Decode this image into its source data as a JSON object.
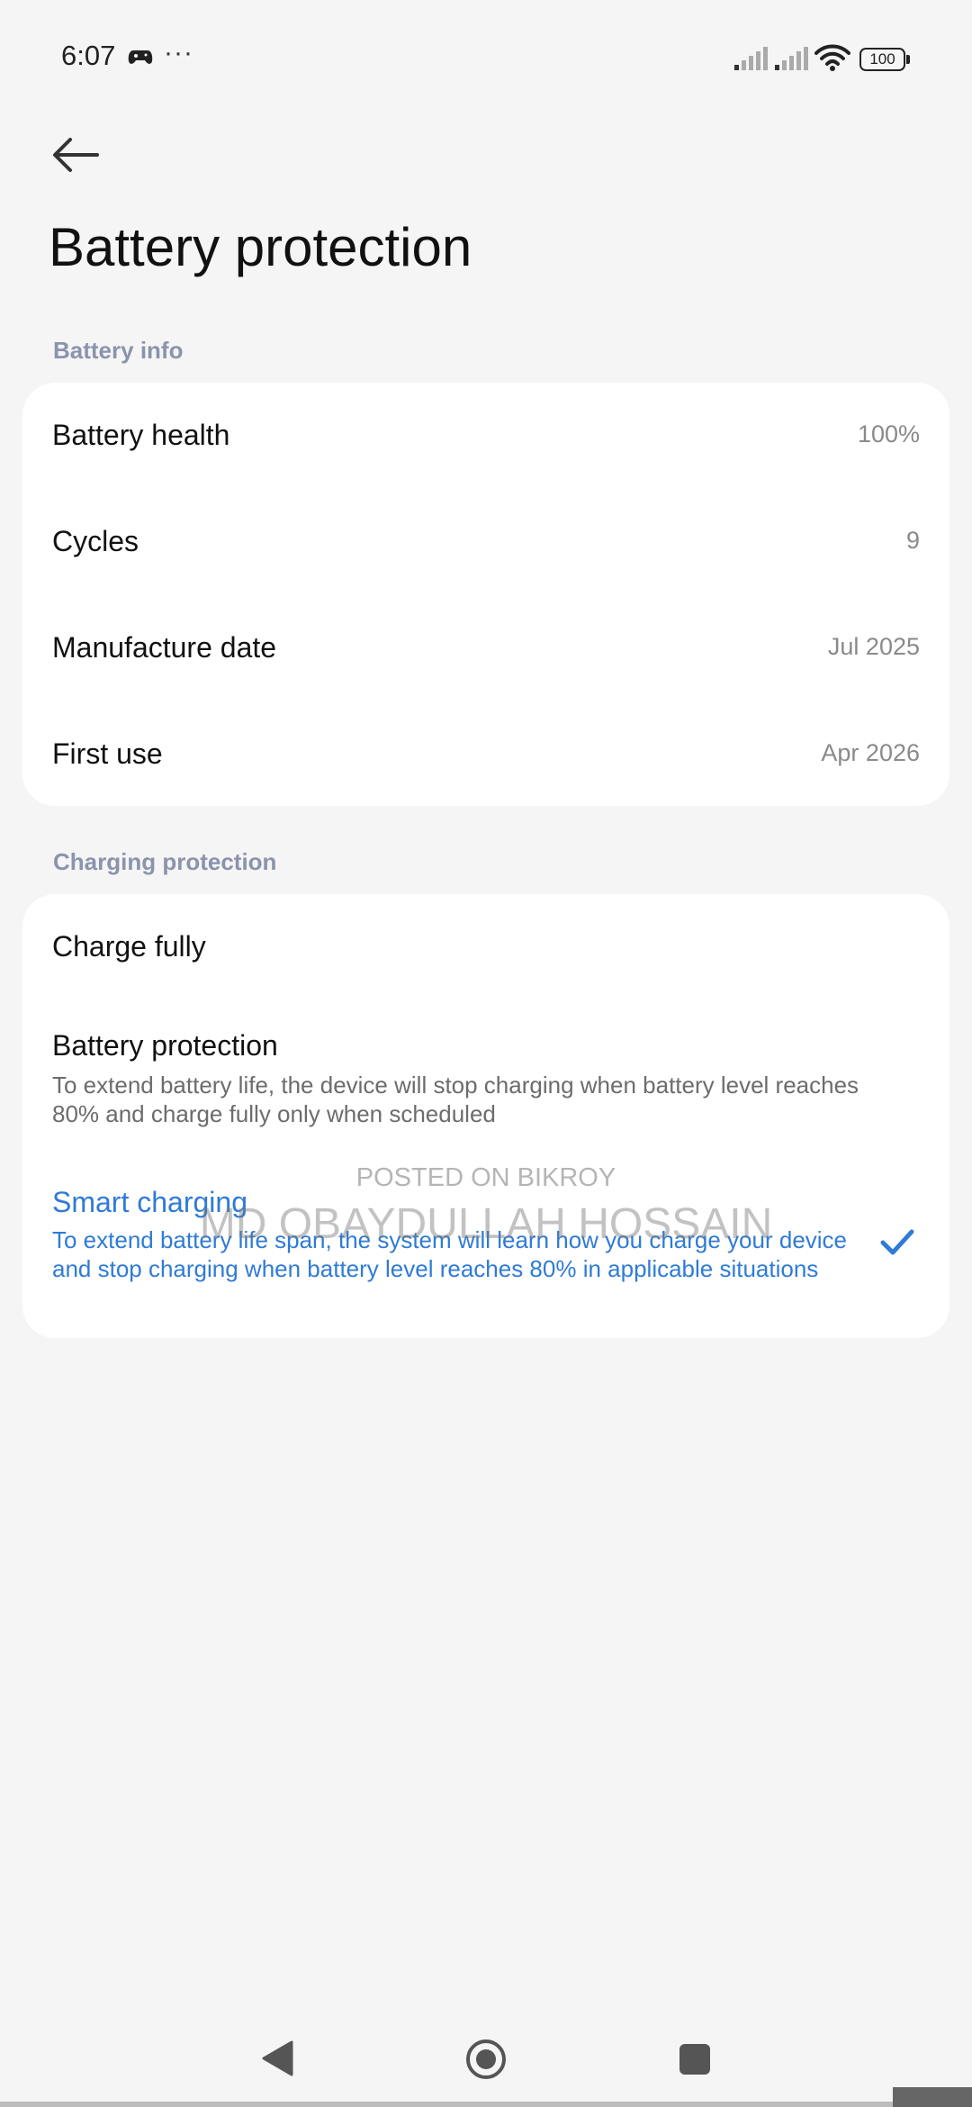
{
  "status_bar": {
    "time": "6:07",
    "more": "···",
    "battery_level": "100",
    "icons": [
      "gamepad-icon",
      "signal-icon",
      "signal-icon",
      "wifi-icon",
      "battery-icon"
    ]
  },
  "header": {
    "back_icon": "arrow-left-icon",
    "title": "Battery protection"
  },
  "battery_info": {
    "section_title": "Battery info",
    "rows": [
      {
        "label": "Battery health",
        "value": "100%"
      },
      {
        "label": "Cycles",
        "value": "9"
      },
      {
        "label": "Manufacture date",
        "value": "Jul 2025"
      },
      {
        "label": "First use",
        "value": "Apr 2026"
      }
    ]
  },
  "charging_protection": {
    "section_title": "Charging protection",
    "options": [
      {
        "label": "Charge fully",
        "description": "",
        "selected": false
      },
      {
        "label": "Battery protection",
        "description": "To extend battery life, the device will stop charging when battery level reaches 80% and charge fully only when scheduled",
        "selected": false
      },
      {
        "label": "Smart charging",
        "description": "To extend battery life span, the system will learn how you charge your device and stop charging when battery level reaches 80% in applicable situations",
        "selected": true
      }
    ],
    "accent_color": "#2f7bd6"
  },
  "watermark": {
    "line1": "POSTED ON BIKROY",
    "line2": "MD OBAYDULLAH HOSSAIN"
  },
  "nav_bar": {
    "icons": [
      "nav-back-icon",
      "nav-home-icon",
      "nav-recents-icon"
    ]
  }
}
